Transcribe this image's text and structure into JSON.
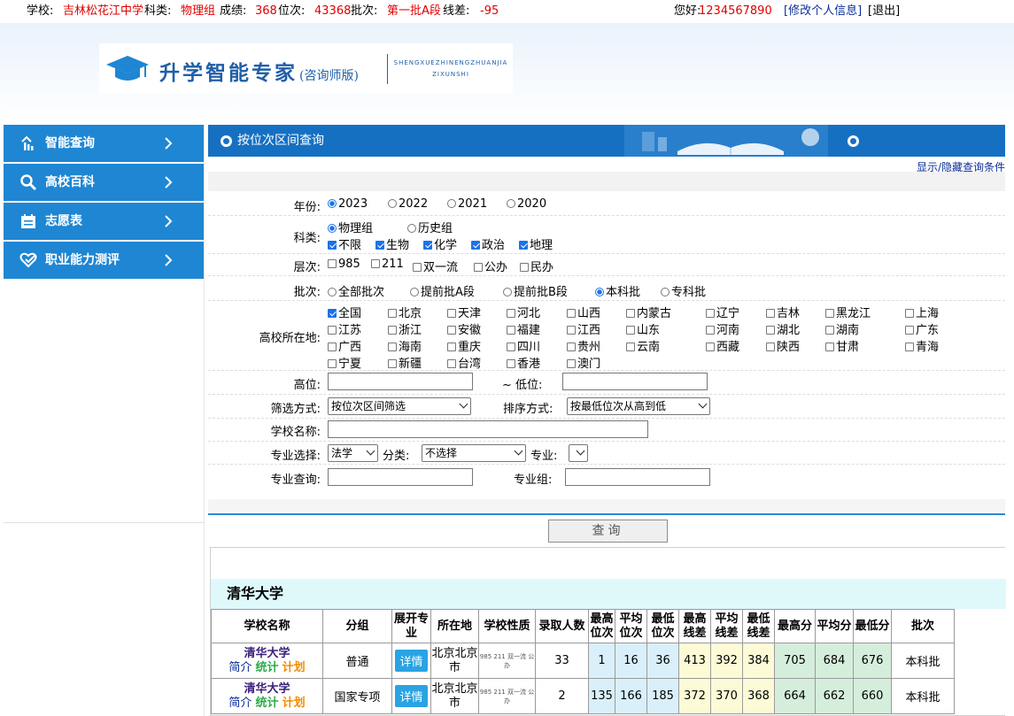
{
  "topbar": {
    "school_label": "学校:",
    "school_value": "吉林松花江中学",
    "subject_label": "科类:",
    "subject_value": "物理组",
    "score_label": "成绩:",
    "score_value": "368",
    "rank_label": "位次:",
    "rank_value": "43368",
    "batch_label": "批次:",
    "batch_value": "第一批A段",
    "gap_label": "线差:",
    "gap_value": "-95",
    "greeting": "您好:",
    "username": "1234567890",
    "edit_info": "[修改个人信息]",
    "logout": "[退出]"
  },
  "logo": {
    "title": "升学智能专家",
    "subtitle": "(咨询师版)",
    "en_line1": "SHENGXUEZHINENGZHUANJIA",
    "en_line2": "ZIXUNSHI"
  },
  "sidebar": {
    "items": [
      {
        "label": "智能查询",
        "icon": "smart-query-icon"
      },
      {
        "label": "高校百科",
        "icon": "search-icon"
      },
      {
        "label": "志愿表",
        "icon": "form-icon"
      },
      {
        "label": "职业能力测评",
        "icon": "heart-check-icon"
      }
    ]
  },
  "panel": {
    "title": "按位次区间查询",
    "toggle": "显示/隐藏查询条件"
  },
  "form": {
    "year": {
      "label": "年份:",
      "options": [
        "2023",
        "2022",
        "2021",
        "2020"
      ],
      "selected": "2023"
    },
    "category": {
      "label": "科类:",
      "groups": [
        "物理组",
        "历史组"
      ],
      "selected": "物理组",
      "subjects": [
        {
          "label": "不限",
          "checked": true
        },
        {
          "label": "生物",
          "checked": true
        },
        {
          "label": "化学",
          "checked": true
        },
        {
          "label": "政治",
          "checked": true
        },
        {
          "label": "地理",
          "checked": true
        }
      ]
    },
    "level": {
      "label": "层次:",
      "options": [
        "985",
        "211",
        "双一流",
        "公办",
        "民办"
      ]
    },
    "batch": {
      "label": "批次:",
      "options": [
        "全部批次",
        "提前批A段",
        "提前批B段",
        "本科批",
        "专科批"
      ],
      "selected": "本科批"
    },
    "location": {
      "label": "高校所在地:",
      "rows": [
        [
          "全国",
          "北京",
          "天津",
          "河北",
          "山西",
          "内蒙古",
          "辽宁",
          "吉林",
          "黑龙江",
          "上海"
        ],
        [
          "江苏",
          "浙江",
          "安徽",
          "福建",
          "江西",
          "山东",
          "河南",
          "湖北",
          "湖南",
          "广东"
        ],
        [
          "广西",
          "海南",
          "重庆",
          "四川",
          "贵州",
          "云南",
          "西藏",
          "陕西",
          "甘肃",
          "青海"
        ],
        [
          "宁夏",
          "新疆",
          "台湾",
          "香港",
          "澳门"
        ]
      ],
      "checked": [
        "全国"
      ]
    },
    "high_rank_label": "高位:",
    "low_rank_label": "~ 低位:",
    "filter_label": "筛选方式:",
    "filter_value": "按位次区间筛选",
    "sort_label": "排序方式:",
    "sort_value": "按最低位次从高到低",
    "school_name_label": "学校名称:",
    "major_select_label": "专业选择:",
    "major_select_value": "法学",
    "class_label": "分类:",
    "class_value": "不选择",
    "major_label": "专业:",
    "major_query_label": "专业查询:",
    "major_group_label": "专业组:",
    "query_button": "查询"
  },
  "results": {
    "university": "清华大学",
    "headers": [
      "学校名称",
      "分组",
      "展开专业",
      "所在地",
      "学校性质",
      "录取人数",
      "最高位次",
      "平均位次",
      "最低位次",
      "最高线差",
      "平均线差",
      "最低线差",
      "最高分",
      "平均分",
      "最低分",
      "批次"
    ],
    "link_intro": "简介",
    "link_stat": "统计",
    "link_plan": "计划",
    "detail_label": "详情",
    "rows": [
      {
        "name": "清华大学",
        "group": "普通",
        "location": "北京北京市",
        "nature": "985 211 双一流 公办",
        "admitted": "33",
        "max_rank": "1",
        "avg_rank": "16",
        "min_rank": "36",
        "max_gap": "413",
        "avg_gap": "392",
        "min_gap": "384",
        "max_score": "705",
        "avg_score": "684",
        "min_score": "676",
        "batch": "本科批"
      },
      {
        "name": "清华大学",
        "group": "国家专项",
        "location": "北京北京市",
        "nature": "985 211 双一流 公办",
        "admitted": "2",
        "max_rank": "135",
        "avg_rank": "166",
        "min_rank": "185",
        "max_gap": "372",
        "avg_gap": "370",
        "min_gap": "368",
        "max_score": "664",
        "avg_score": "662",
        "min_score": "660",
        "batch": "本科批"
      }
    ]
  },
  "colors": {
    "sidebar": "#1f86d3",
    "header": "#1670c2",
    "highlight_yellow": "#ffff00",
    "highlight_green": "#90e38f",
    "highlight_blue": "#d9f0fa"
  }
}
